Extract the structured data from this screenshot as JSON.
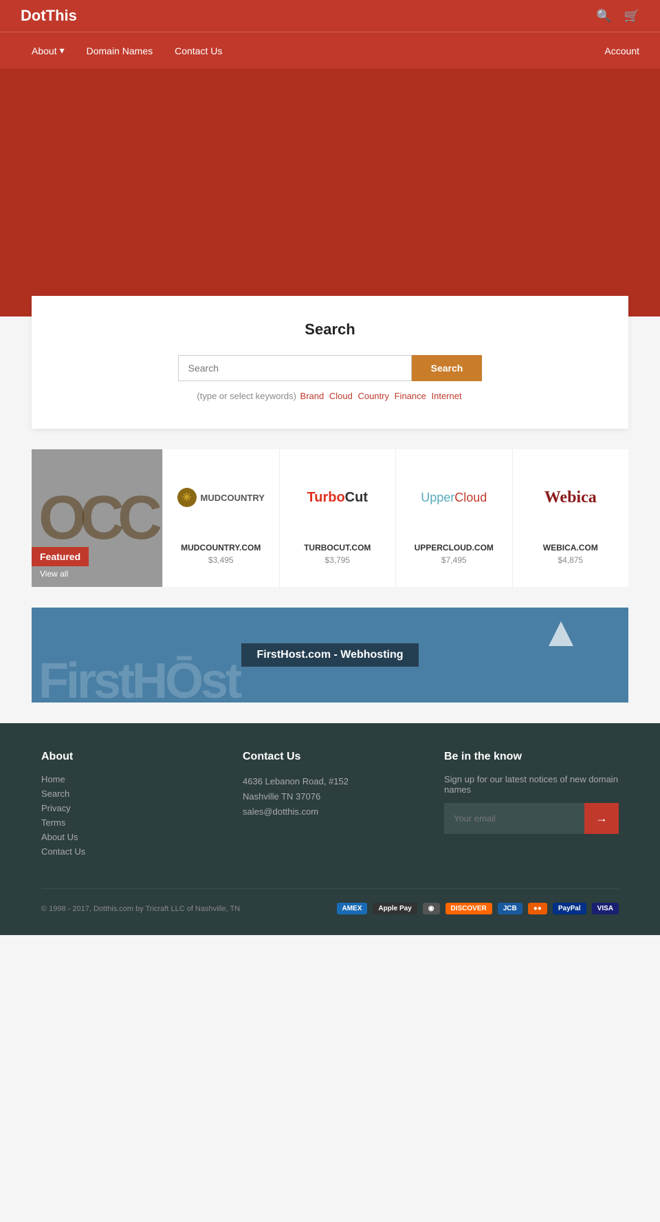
{
  "site": {
    "logo": "DotThis"
  },
  "header": {
    "search_icon": "🔍",
    "cart_icon": "🛒",
    "account_label": "Account"
  },
  "nav": {
    "items": [
      {
        "label": "About",
        "has_dropdown": true
      },
      {
        "label": "Domain Names",
        "has_dropdown": false
      },
      {
        "label": "Contact Us",
        "has_dropdown": false
      }
    ],
    "account_label": "Account"
  },
  "search": {
    "title": "Search",
    "input_placeholder": "Search",
    "button_label": "Search",
    "keywords_prefix": "(type or select keywords)",
    "keywords": [
      "Brand",
      "Cloud",
      "Country",
      "Finance",
      "Internet"
    ]
  },
  "featured": {
    "label": "Featured",
    "view_all": "View all",
    "bg_text": "OCC"
  },
  "products": [
    {
      "name": "MUDCOUNTRY.COM",
      "price": "$3,495",
      "logo_type": "mudcountry",
      "logo_text": "MUDCOUNTRY"
    },
    {
      "name": "TURBOCUT.COM",
      "price": "$3,795",
      "logo_type": "turbocut",
      "logo_text1": "Turbo",
      "logo_text2": "Cut"
    },
    {
      "name": "UPPERCLOUD.COM",
      "price": "$7,495",
      "logo_type": "uppercloud",
      "logo_text1": "Upper",
      "logo_text2": "Cloud"
    },
    {
      "name": "WEBICA.COM",
      "price": "$4,875",
      "logo_type": "webica",
      "logo_text": "Webica"
    }
  ],
  "ad_banner": {
    "label": "FirstHost.com - Webhosting",
    "bg_text": "FirstHOst"
  },
  "footer": {
    "about_heading": "About",
    "about_links": [
      "Home",
      "Search",
      "Privacy",
      "Terms",
      "About Us",
      "Contact Us"
    ],
    "contact_heading": "Contact Us",
    "contact_address": "4636 Lebanon Road, #152",
    "contact_city": "Nashville TN 37076",
    "contact_email": "sales@dotthis.com",
    "newsletter_heading": "Be in the know",
    "newsletter_desc": "Sign up for our latest notices of new domain names",
    "newsletter_placeholder": "Your email",
    "newsletter_button": "→",
    "copyright": "© 1998 - 2017, Dotthis.com by Tricraft LLC of Nashville, TN",
    "payment_methods": [
      "AMEX",
      "Apple Pay",
      "Diners",
      "DISCOVER",
      "JCB",
      "master",
      "PayPal",
      "VISA"
    ]
  }
}
